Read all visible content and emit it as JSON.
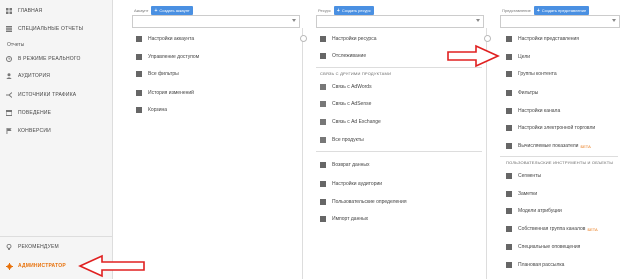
{
  "nav": {
    "home": "ГЛАВНАЯ",
    "custom_reports": "СПЕЦИАЛЬНЫЕ ОТЧЕТЫ",
    "reports_section": "Отчеты",
    "realtime": "В РЕЖИМЕ РЕАЛЬНОГО",
    "audience": "АУДИТОРИЯ",
    "acquisition": "ИСТОЧНИКИ ТРАФИКА",
    "behavior": "ПОВЕДЕНИЕ",
    "conversions": "КОНВЕРСИИ",
    "recommended": "РЕКОМЕНДУЕМ",
    "admin": "АДМИНИСТРАТОР"
  },
  "account": {
    "label": "Аккаунт",
    "create": "Создать аккаунт",
    "items": [
      "Настройки аккаунта",
      "Управление доступом",
      "Все фильтры",
      "История изменений",
      "Корзина"
    ]
  },
  "property": {
    "label": "Ресурс",
    "create": "Создать ресурс",
    "items": [
      "Настройки ресурса",
      "Отслеживание"
    ],
    "links_title": "СВЯЗЬ С ДРУГИМИ ПРОДУКТАМИ",
    "links": [
      "Связь с AdWords",
      "Связь с AdSense",
      "Связь с Ad Exchange",
      "Все продукты"
    ],
    "more": [
      "Возврат данных",
      "Настройки аудитории",
      "Пользовательские определения",
      "Импорт данных"
    ]
  },
  "view": {
    "label": "Представление",
    "create": "Создать представление",
    "items": [
      "Настройки представления",
      "Цели",
      "Группы контента",
      "Фильтры",
      "Настройки канала",
      "Настройки электронной торговли",
      "Вычисляемые показатели"
    ],
    "beta": "БЕТА",
    "tools_title": "ПОЛЬЗОВАТЕЛЬСКИЕ ИНСТРУМЕНТЫ И ОБЪЕКТЫ",
    "tools": [
      "Сегменты",
      "Заметки",
      "Модели атрибуции",
      "Собственная группа каналов",
      "Специальные оповещения",
      "Плановая рассылка"
    ]
  },
  "colors": {
    "accent": "#e8710a",
    "button": "#4a90e2",
    "arrow": "#e02020"
  }
}
